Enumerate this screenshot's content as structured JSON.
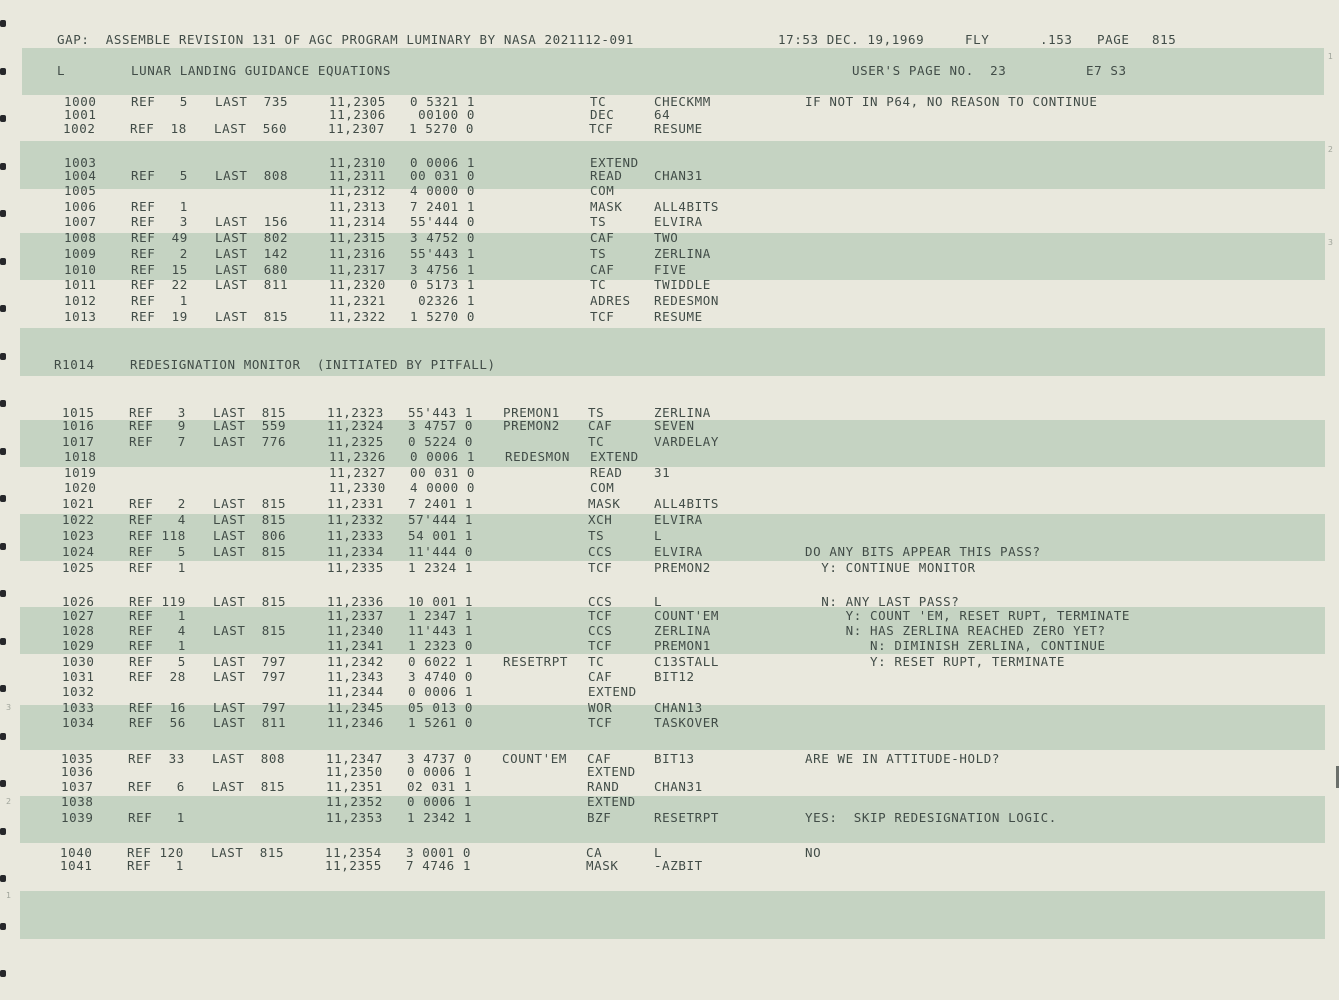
{
  "header": {
    "program_line": "GAP:  ASSEMBLE REVISION 131 OF AGC PROGRAM LUMINARY BY NASA 2021112-091",
    "timestamp": "17:53 DEC. 19,1969",
    "mode": "FLY",
    "sequence": ".153",
    "page_label": "PAGE",
    "page_number": "815"
  },
  "section_title": {
    "marker": "L",
    "title": "LUNAR LANDING GUIDANCE EQUATIONS",
    "users_page": "USER'S PAGE NO.  23",
    "code": "E7 S3"
  },
  "subtitle": {
    "label": "R1014",
    "text": "REDESIGNATION MONITOR  (INITIATED BY PITFALL)"
  },
  "listing": [
    {
      "line": "1000",
      "ref": "REF   5",
      "last": "LAST  735",
      "addr": "11,2305",
      "word": "0 5321 1",
      "label": "",
      "op": "TC",
      "operand": "CHECKMM",
      "comment": "IF NOT IN P64, NO REASON TO CONTINUE"
    },
    {
      "line": "1001",
      "ref": "",
      "last": "",
      "addr": "11,2306",
      "word": " 00100 0",
      "label": "",
      "op": "DEC",
      "operand": "64",
      "comment": ""
    },
    {
      "line": "1002",
      "ref": "REF  18",
      "last": "LAST  560",
      "addr": "11,2307",
      "word": "1 5270 0",
      "label": "",
      "op": "TCF",
      "operand": "RESUME",
      "comment": ""
    },
    {
      "line": "1003",
      "ref": "",
      "last": "",
      "addr": "11,2310",
      "word": "0 0006 1",
      "label": "",
      "op": "EXTEND",
      "operand": "",
      "comment": ""
    },
    {
      "line": "1004",
      "ref": "REF   5",
      "last": "LAST  808",
      "addr": "11,2311",
      "word": "00 031 0",
      "label": "",
      "op": "READ",
      "operand": "CHAN31",
      "comment": ""
    },
    {
      "line": "1005",
      "ref": "",
      "last": "",
      "addr": "11,2312",
      "word": "4 0000 0",
      "label": "",
      "op": "COM",
      "operand": "",
      "comment": ""
    },
    {
      "line": "1006",
      "ref": "REF   1",
      "last": "",
      "addr": "11,2313",
      "word": "7 2401 1",
      "label": "",
      "op": "MASK",
      "operand": "ALL4BITS",
      "comment": ""
    },
    {
      "line": "1007",
      "ref": "REF   3",
      "last": "LAST  156",
      "addr": "11,2314",
      "word": "55'444 0",
      "label": "",
      "op": "TS",
      "operand": "ELVIRA",
      "comment": ""
    },
    {
      "line": "1008",
      "ref": "REF  49",
      "last": "LAST  802",
      "addr": "11,2315",
      "word": "3 4752 0",
      "label": "",
      "op": "CAF",
      "operand": "TWO",
      "comment": ""
    },
    {
      "line": "1009",
      "ref": "REF   2",
      "last": "LAST  142",
      "addr": "11,2316",
      "word": "55'443 1",
      "label": "",
      "op": "TS",
      "operand": "ZERLINA",
      "comment": ""
    },
    {
      "line": "1010",
      "ref": "REF  15",
      "last": "LAST  680",
      "addr": "11,2317",
      "word": "3 4756 1",
      "label": "",
      "op": "CAF",
      "operand": "FIVE",
      "comment": ""
    },
    {
      "line": "1011",
      "ref": "REF  22",
      "last": "LAST  811",
      "addr": "11,2320",
      "word": "0 5173 1",
      "label": "",
      "op": "TC",
      "operand": "TWIDDLE",
      "comment": ""
    },
    {
      "line": "1012",
      "ref": "REF   1",
      "last": "",
      "addr": "11,2321",
      "word": " 02326 1",
      "label": "",
      "op": "ADRES",
      "operand": "REDESMON",
      "comment": ""
    },
    {
      "line": "1013",
      "ref": "REF  19",
      "last": "LAST  815",
      "addr": "11,2322",
      "word": "1 5270 0",
      "label": "",
      "op": "TCF",
      "operand": "RESUME",
      "comment": ""
    },
    {
      "line": "1015",
      "ref": "REF   3",
      "last": "LAST  815",
      "addr": "11,2323",
      "word": "55'443 1",
      "label": "PREMON1",
      "op": "TS",
      "operand": "ZERLINA",
      "comment": ""
    },
    {
      "line": "1016",
      "ref": "REF   9",
      "last": "LAST  559",
      "addr": "11,2324",
      "word": "3 4757 0",
      "label": "PREMON2",
      "op": "CAF",
      "operand": "SEVEN",
      "comment": ""
    },
    {
      "line": "1017",
      "ref": "REF   7",
      "last": "LAST  776",
      "addr": "11,2325",
      "word": "0 5224 0",
      "label": "",
      "op": "TC",
      "operand": "VARDELAY",
      "comment": ""
    },
    {
      "line": "1018",
      "ref": "",
      "last": "",
      "addr": "11,2326",
      "word": "0 0006 1",
      "label": "REDESMON",
      "op": "EXTEND",
      "operand": "",
      "comment": ""
    },
    {
      "line": "1019",
      "ref": "",
      "last": "",
      "addr": "11,2327",
      "word": "00 031 0",
      "label": "",
      "op": "READ",
      "operand": "31",
      "comment": ""
    },
    {
      "line": "1020",
      "ref": "",
      "last": "",
      "addr": "11,2330",
      "word": "4 0000 0",
      "label": "",
      "op": "COM",
      "operand": "",
      "comment": ""
    },
    {
      "line": "1021",
      "ref": "REF   2",
      "last": "LAST  815",
      "addr": "11,2331",
      "word": "7 2401 1",
      "label": "",
      "op": "MASK",
      "operand": "ALL4BITS",
      "comment": ""
    },
    {
      "line": "1022",
      "ref": "REF   4",
      "last": "LAST  815",
      "addr": "11,2332",
      "word": "57'444 1",
      "label": "",
      "op": "XCH",
      "operand": "ELVIRA",
      "comment": ""
    },
    {
      "line": "1023",
      "ref": "REF 118",
      "last": "LAST  806",
      "addr": "11,2333",
      "word": "54 001 1",
      "label": "",
      "op": "TS",
      "operand": "L",
      "comment": ""
    },
    {
      "line": "1024",
      "ref": "REF   5",
      "last": "LAST  815",
      "addr": "11,2334",
      "word": "11'444 0",
      "label": "",
      "op": "CCS",
      "operand": "ELVIRA",
      "comment": "DO ANY BITS APPEAR THIS PASS?"
    },
    {
      "line": "1025",
      "ref": "REF   1",
      "last": "",
      "addr": "11,2335",
      "word": "1 2324 1",
      "label": "",
      "op": "TCF",
      "operand": "PREMON2",
      "comment": "  Y: CONTINUE MONITOR"
    },
    {
      "line": "1026",
      "ref": "REF 119",
      "last": "LAST  815",
      "addr": "11,2336",
      "word": "10 001 1",
      "label": "",
      "op": "CCS",
      "operand": "L",
      "comment": "  N: ANY LAST PASS?"
    },
    {
      "line": "1027",
      "ref": "REF   1",
      "last": "",
      "addr": "11,2337",
      "word": "1 2347 1",
      "label": "",
      "op": "TCF",
      "operand": "COUNT'EM",
      "comment": "     Y: COUNT 'EM, RESET RUPT, TERMINATE"
    },
    {
      "line": "1028",
      "ref": "REF   4",
      "last": "LAST  815",
      "addr": "11,2340",
      "word": "11'443 1",
      "label": "",
      "op": "CCS",
      "operand": "ZERLINA",
      "comment": "     N: HAS ZERLINA REACHED ZERO YET?"
    },
    {
      "line": "1029",
      "ref": "REF   1",
      "last": "",
      "addr": "11,2341",
      "word": "1 2323 0",
      "label": "",
      "op": "TCF",
      "operand": "PREMON1",
      "comment": "        N: DIMINISH ZERLINA, CONTINUE"
    },
    {
      "line": "1030",
      "ref": "REF   5",
      "last": "LAST  797",
      "addr": "11,2342",
      "word": "0 6022 1",
      "label": "RESETRPT",
      "op": "TC",
      "operand": "C13STALL",
      "comment": "        Y: RESET RUPT, TERMINATE"
    },
    {
      "line": "1031",
      "ref": "REF  28",
      "last": "LAST  797",
      "addr": "11,2343",
      "word": "3 4740 0",
      "label": "",
      "op": "CAF",
      "operand": "BIT12",
      "comment": ""
    },
    {
      "line": "1032",
      "ref": "",
      "last": "",
      "addr": "11,2344",
      "word": "0 0006 1",
      "label": "",
      "op": "EXTEND",
      "operand": "",
      "comment": ""
    },
    {
      "line": "1033",
      "ref": "REF  16",
      "last": "LAST  797",
      "addr": "11,2345",
      "word": "05 013 0",
      "label": "",
      "op": "WOR",
      "operand": "CHAN13",
      "comment": ""
    },
    {
      "line": "1034",
      "ref": "REF  56",
      "last": "LAST  811",
      "addr": "11,2346",
      "word": "1 5261 0",
      "label": "",
      "op": "TCF",
      "operand": "TASKOVER",
      "comment": ""
    },
    {
      "line": "1035",
      "ref": "REF  33",
      "last": "LAST  808",
      "addr": "11,2347",
      "word": "3 4737 0",
      "label": "COUNT'EM",
      "op": "CAF",
      "operand": "BIT13",
      "comment": "ARE WE IN ATTITUDE-HOLD?"
    },
    {
      "line": "1036",
      "ref": "",
      "last": "",
      "addr": "11,2350",
      "word": "0 0006 1",
      "label": "",
      "op": "EXTEND",
      "operand": "",
      "comment": ""
    },
    {
      "line": "1037",
      "ref": "REF   6",
      "last": "LAST  815",
      "addr": "11,2351",
      "word": "02 031 1",
      "label": "",
      "op": "RAND",
      "operand": "CHAN31",
      "comment": ""
    },
    {
      "line": "1038",
      "ref": "",
      "last": "",
      "addr": "11,2352",
      "word": "0 0006 1",
      "label": "",
      "op": "EXTEND",
      "operand": "",
      "comment": ""
    },
    {
      "line": "1039",
      "ref": "REF   1",
      "last": "",
      "addr": "11,2353",
      "word": "1 2342 1",
      "label": "",
      "op": "BZF",
      "operand": "RESETRPT",
      "comment": "YES:  SKIP REDESIGNATION LOGIC."
    },
    {
      "line": "1040",
      "ref": "REF 120",
      "last": "LAST  815",
      "addr": "11,2354",
      "word": "3 0001 0",
      "label": "",
      "op": "CA",
      "operand": "L",
      "comment": "NO"
    },
    {
      "line": "1041",
      "ref": "REF   1",
      "last": "",
      "addr": "11,2355",
      "word": "7 4746 1",
      "label": "",
      "op": "MASK",
      "operand": "-AZBIT",
      "comment": ""
    }
  ],
  "margin_marks": [
    "1",
    "2",
    "3",
    "3",
    "2",
    "1"
  ]
}
